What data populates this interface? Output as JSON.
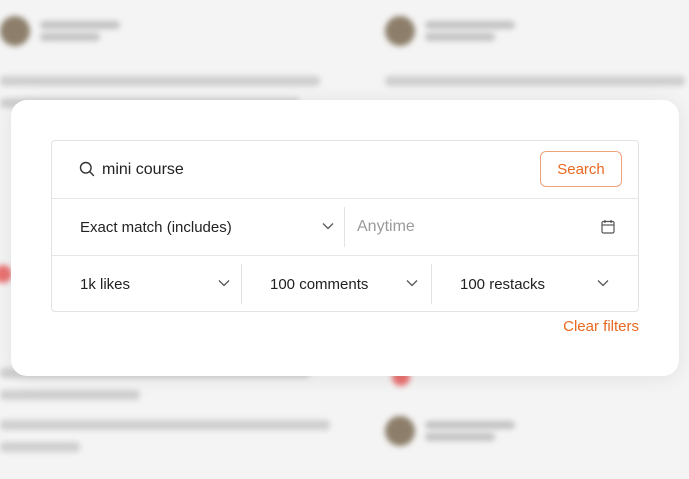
{
  "search": {
    "query": "mini course",
    "button_label": "Search"
  },
  "filters": {
    "match_mode": "Exact match (includes)",
    "date_placeholder": "Anytime",
    "likes": "1k likes",
    "comments": "100 comments",
    "restacks": "100 restacks",
    "clear_label": "Clear filters"
  },
  "colors": {
    "accent": "#e8681f",
    "accent_border": "#f0a37a",
    "text": "#222222",
    "muted": "#9a9a9a"
  },
  "icons": {
    "search": "magnifier",
    "chevron": "chevron-down",
    "calendar": "calendar"
  }
}
